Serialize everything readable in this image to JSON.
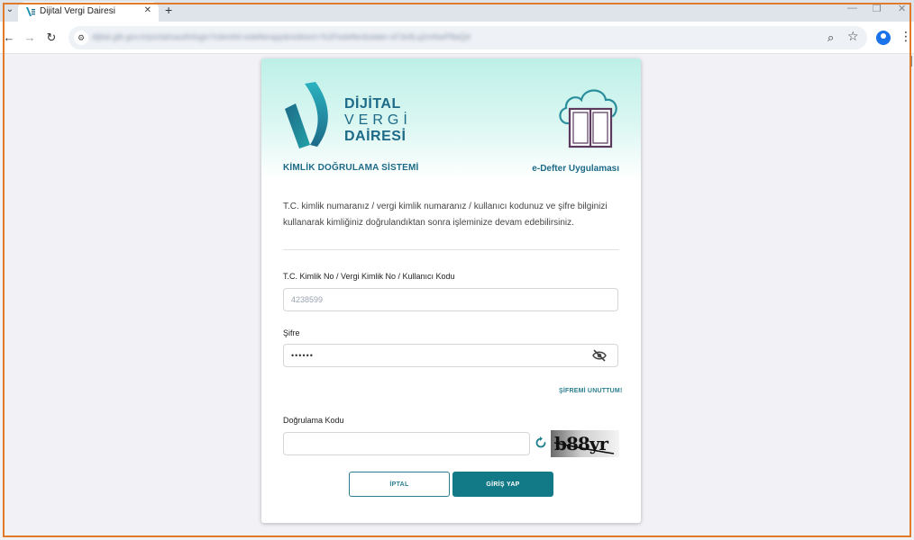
{
  "browser": {
    "tab_title": "Dijital Vergi Dairesi",
    "url": "dijital.gib.gov.tr/portal/oauth/login?clientId=edefterapp&redirect=%2Fedefter&state=xF3s9Lq2mNwP8aQd"
  },
  "header": {
    "logo_line1": "DİJİTAL",
    "logo_line2": "VERGİ",
    "logo_line3": "DAİRESİ",
    "system_title": "KİMLİK DOĞRULAMA SİSTEMİ",
    "app_title": "e-Defter Uygulaması"
  },
  "intro_text": "T.C. kimlik numaranız / vergi kimlik numaranız / kullanıcı kodunuz ve şifre bilginizi kullanarak kimliğiniz doğrulandıktan sonra işleminize devam edebilirsiniz.",
  "form": {
    "user_label": "T.C. Kimlik No / Vergi Kimlik No / Kullanıcı Kodu",
    "user_value": "4238599",
    "password_label": "Şifre",
    "password_value": "••••••",
    "forgot_link": "ŞİFREMİ UNUTTUM!",
    "code_label": "Doğrulama Kodu",
    "code_value": "",
    "captcha_text": "b88yr",
    "cancel_label": "İPTAL",
    "login_label": "GİRİŞ YAP"
  },
  "colors": {
    "brand": "#1d6a88",
    "accent": "#127a87",
    "frame": "#e07b2c"
  }
}
